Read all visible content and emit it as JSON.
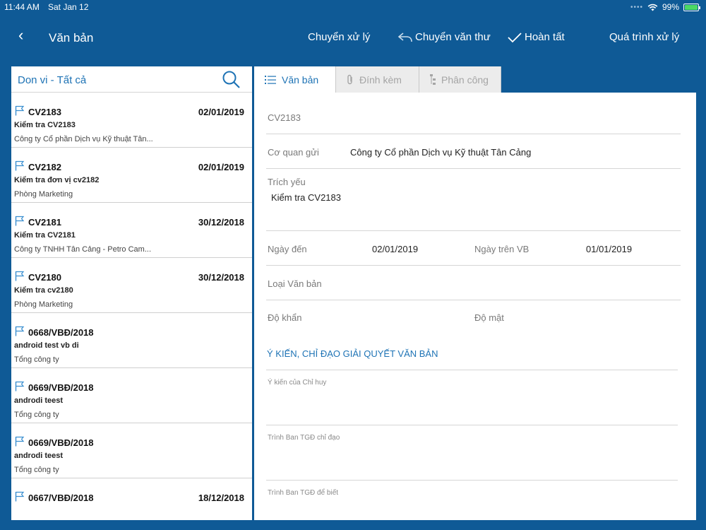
{
  "status_bar": {
    "time": "11:44 AM",
    "date": "Sat Jan 12",
    "battery": "99%"
  },
  "nav": {
    "title": "Văn bản",
    "actions": [
      "Chuyển xử lý",
      "Chuyển văn thư",
      "Hoàn tất",
      "Quá trình xử lý"
    ]
  },
  "filter": {
    "label": "Don vi - Tất cả"
  },
  "documents": [
    {
      "code": "CV2183",
      "date": "02/01/2019",
      "subject": "Kiểm tra CV2183",
      "org": "Công ty Cổ phần Dịch vụ Kỹ thuật Tân..."
    },
    {
      "code": "CV2182",
      "date": "02/01/2019",
      "subject": "Kiểm tra đơn vị cv2182",
      "org": "Phòng Marketing"
    },
    {
      "code": "CV2181",
      "date": "30/12/2018",
      "subject": "Kiểm tra CV2181",
      "org": "Công ty TNHH Tân Cảng - Petro Cam..."
    },
    {
      "code": "CV2180",
      "date": "30/12/2018",
      "subject": "Kiểm tra cv2180",
      "org": "Phòng Marketing"
    },
    {
      "code": "0668/VBĐ/2018",
      "date": "",
      "subject": "android test vb di",
      "org": "Tổng công ty"
    },
    {
      "code": "0669/VBĐ/2018",
      "date": "",
      "subject": "androdi teest",
      "org": "Tổng công ty"
    },
    {
      "code": "0669/VBĐ/2018",
      "date": "",
      "subject": "androdi teest",
      "org": "Tổng công ty"
    },
    {
      "code": "0667/VBĐ/2018",
      "date": "18/12/2018",
      "subject": "",
      "org": ""
    }
  ],
  "tabs": [
    "Văn bản",
    "Đính kèm",
    "Phân công"
  ],
  "detail": {
    "code": "CV2183",
    "agency_label": "Cơ quan gửi",
    "agency_value": "Công ty Cổ phần Dịch vụ Kỹ thuật Tân Cảng",
    "summary_label": "Trích yếu",
    "summary_value": "Kiểm tra CV2183",
    "arrival_label": "Ngày đến",
    "arrival_value": "02/01/2019",
    "doc_date_label": "Ngày trên VB",
    "doc_date_value": "01/01/2019",
    "type_label": "Loại Văn bản",
    "urgency_label": "Độ khẩn",
    "secrecy_label": "Độ mật",
    "section_title": "Ý KIẾN, CHỈ ĐẠO GIẢI QUYẾT VĂN BẢN",
    "opinion_labels": [
      "Ý kiến của Chỉ huy",
      "Trình Ban TGĐ chỉ đạo",
      "Trình Ban TGĐ để biết"
    ]
  },
  "colors": {
    "primary": "#0f5a96",
    "accent": "#1e73b5"
  }
}
